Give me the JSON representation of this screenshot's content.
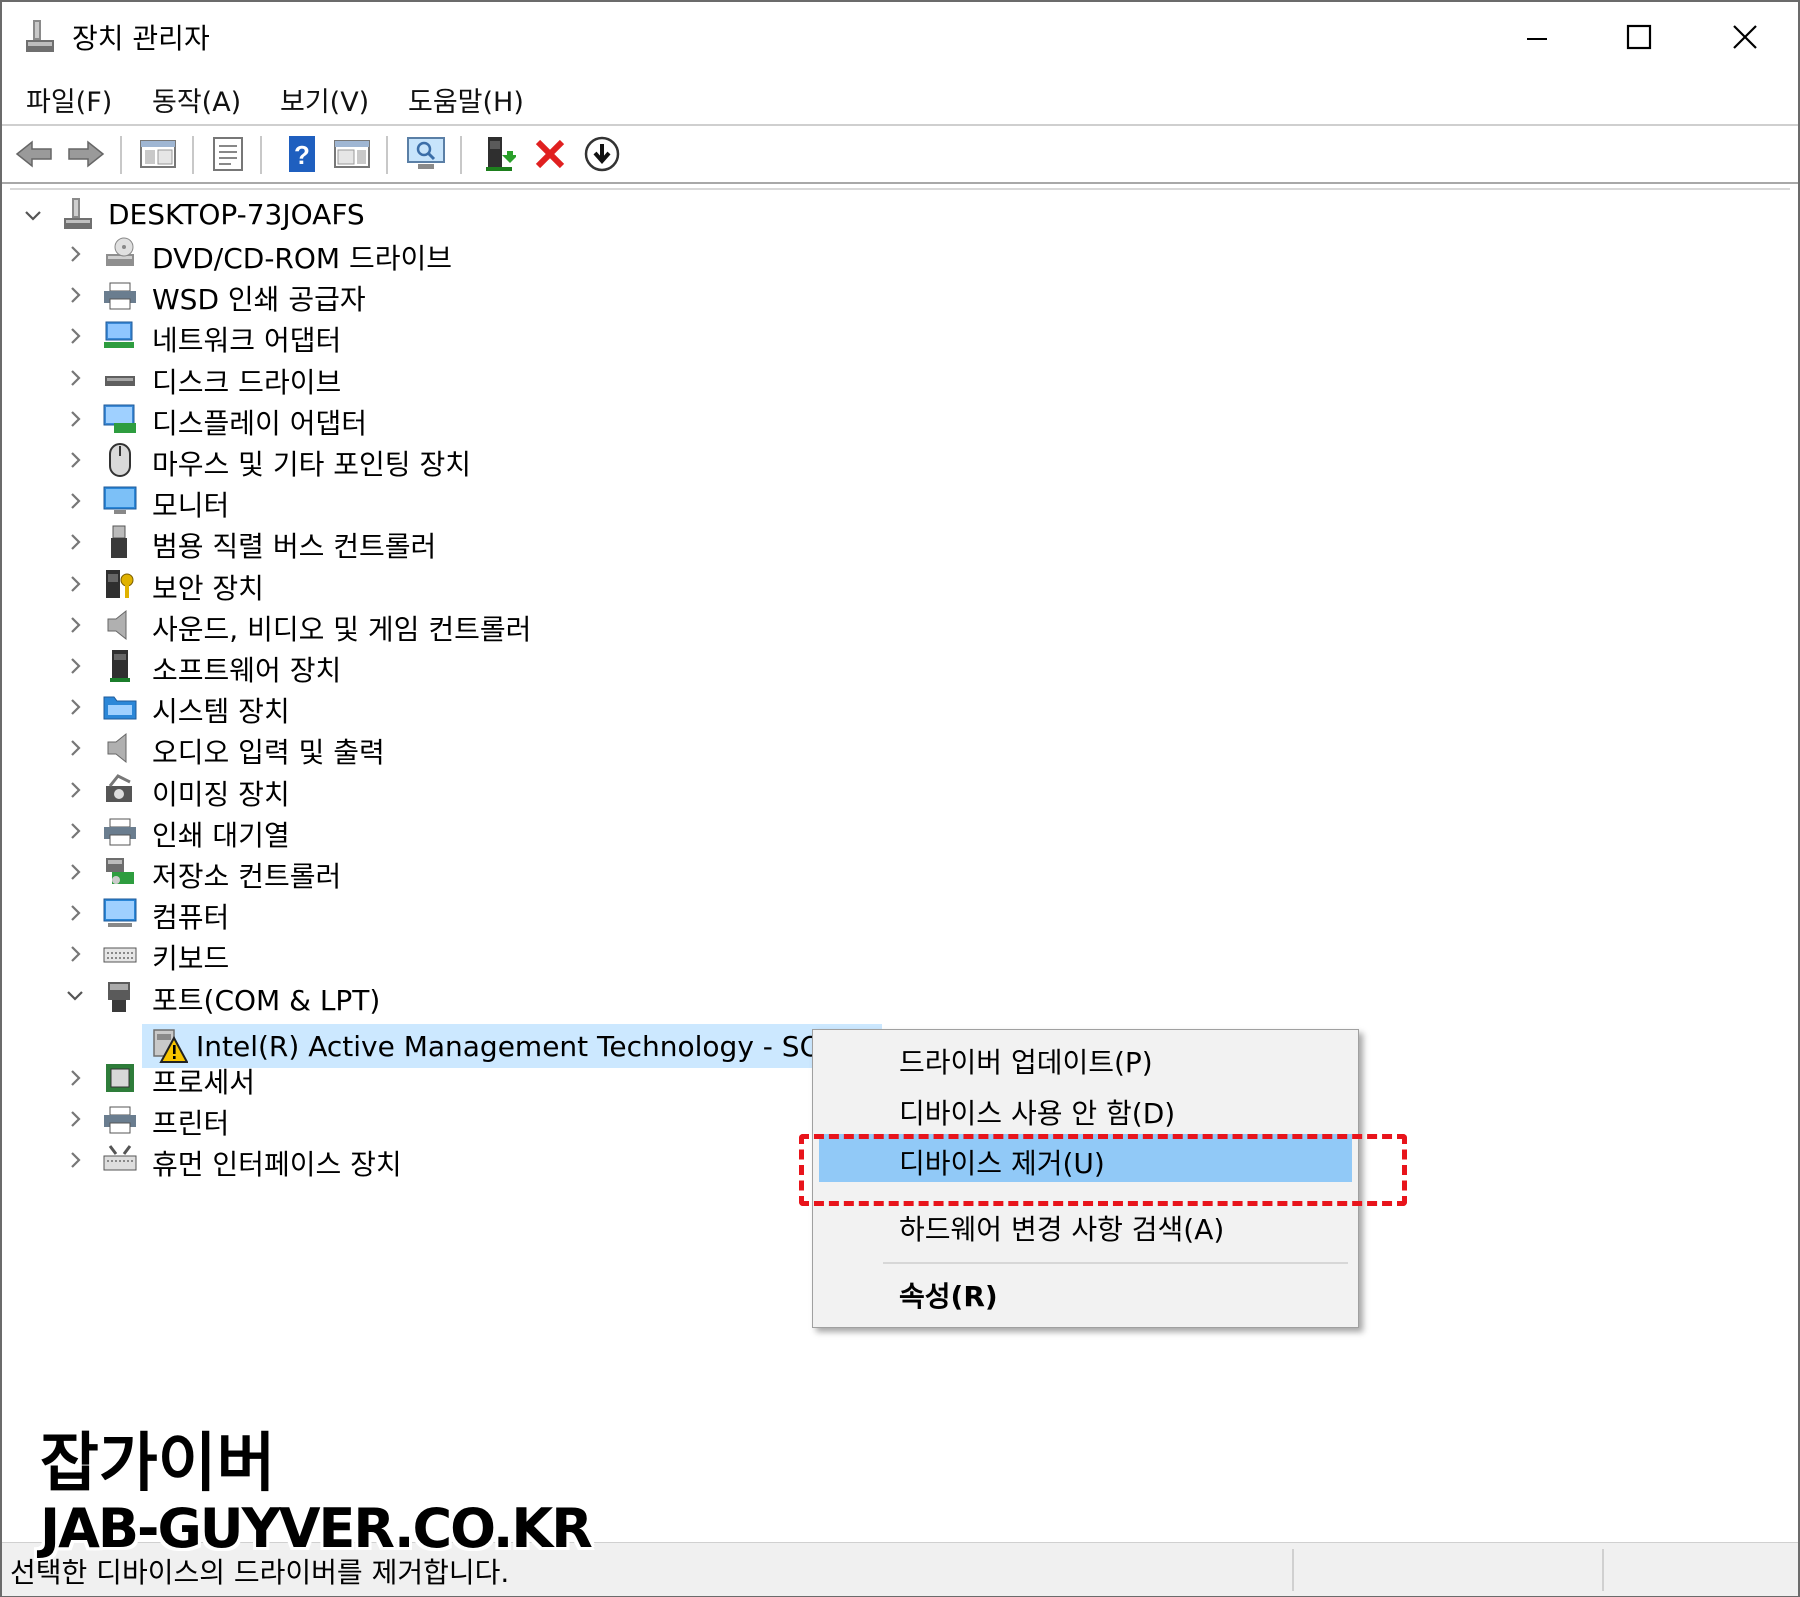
{
  "window": {
    "title": "장치 관리자",
    "controls": [
      "minimize",
      "maximize",
      "close"
    ]
  },
  "menubar": {
    "items": [
      "파일(F)",
      "동작(A)",
      "보기(V)",
      "도움말(H)"
    ]
  },
  "toolbar": {
    "icons": [
      "back-arrow-icon",
      "forward-arrow-icon",
      "show-hide-console-tree-icon",
      "properties-icon",
      "help-icon",
      "action-pane-icon",
      "scan-hardware-icon",
      "update-driver-icon",
      "uninstall-device-icon",
      "download-icon"
    ]
  },
  "tree": {
    "root": "DESKTOP-73JOAFS",
    "categories": [
      {
        "label": "DVD/CD-ROM 드라이브",
        "icon": "dvd-drive-icon",
        "expanded": false
      },
      {
        "label": "WSD 인쇄 공급자",
        "icon": "printer-icon",
        "expanded": false
      },
      {
        "label": "네트워크 어댑터",
        "icon": "network-adapter-icon",
        "expanded": false
      },
      {
        "label": "디스크 드라이브",
        "icon": "disk-drive-icon",
        "expanded": false
      },
      {
        "label": "디스플레이 어댑터",
        "icon": "display-adapter-icon",
        "expanded": false
      },
      {
        "label": "마우스 및 기타 포인팅 장치",
        "icon": "mouse-icon",
        "expanded": false
      },
      {
        "label": "모니터",
        "icon": "monitor-icon",
        "expanded": false
      },
      {
        "label": "범용 직렬 버스 컨트롤러",
        "icon": "usb-icon",
        "expanded": false
      },
      {
        "label": "보안 장치",
        "icon": "security-device-icon",
        "expanded": false
      },
      {
        "label": "사운드, 비디오 및 게임 컨트롤러",
        "icon": "speaker-icon",
        "expanded": false
      },
      {
        "label": "소프트웨어 장치",
        "icon": "software-device-icon",
        "expanded": false
      },
      {
        "label": "시스템 장치",
        "icon": "system-folder-icon",
        "expanded": false
      },
      {
        "label": "오디오 입력 및 출력",
        "icon": "speaker-icon",
        "expanded": false
      },
      {
        "label": "이미징 장치",
        "icon": "camera-icon",
        "expanded": false
      },
      {
        "label": "인쇄 대기열",
        "icon": "printer-icon",
        "expanded": false
      },
      {
        "label": "저장소 컨트롤러",
        "icon": "storage-controller-icon",
        "expanded": false
      },
      {
        "label": "컴퓨터",
        "icon": "computer-icon",
        "expanded": false
      },
      {
        "label": "키보드",
        "icon": "keyboard-icon",
        "expanded": false
      },
      {
        "label": "포트(COM & LPT)",
        "icon": "port-icon",
        "expanded": true
      },
      {
        "label": "프로세서",
        "icon": "processor-icon",
        "expanded": false
      },
      {
        "label": "프린터",
        "icon": "printer-icon",
        "expanded": false
      },
      {
        "label": "휴먼 인터페이스 장치",
        "icon": "hid-icon",
        "expanded": false
      }
    ],
    "selected_child": {
      "label": "Intel(R) Active Management Technology - SOL(CC",
      "icon": "warning-icon"
    }
  },
  "context_menu": {
    "items": [
      {
        "label": "드라이버 업데이트(P)",
        "highlighted": false
      },
      {
        "label": "디바이스 사용 안 함(D)",
        "highlighted": false
      },
      {
        "label": "디바이스 제거(U)",
        "highlighted": true
      },
      {
        "label": "하드웨어 변경 사항 검색(A)",
        "highlighted": false
      },
      {
        "label": "속성(R)",
        "highlighted": false,
        "bold": true
      }
    ]
  },
  "status_bar": {
    "text": "선택한 디바이스의 드라이버를 제거합니다."
  },
  "watermark": {
    "line1": "잡가이버",
    "line2": "JAB-GUYVER.CO.KR"
  },
  "colors": {
    "selection": "#cce8ff",
    "menu_highlight": "#91c9f7",
    "annotation_dash": "#e8141b",
    "uninstall_red": "#e02020",
    "help_blue": "#1f5fbf"
  }
}
